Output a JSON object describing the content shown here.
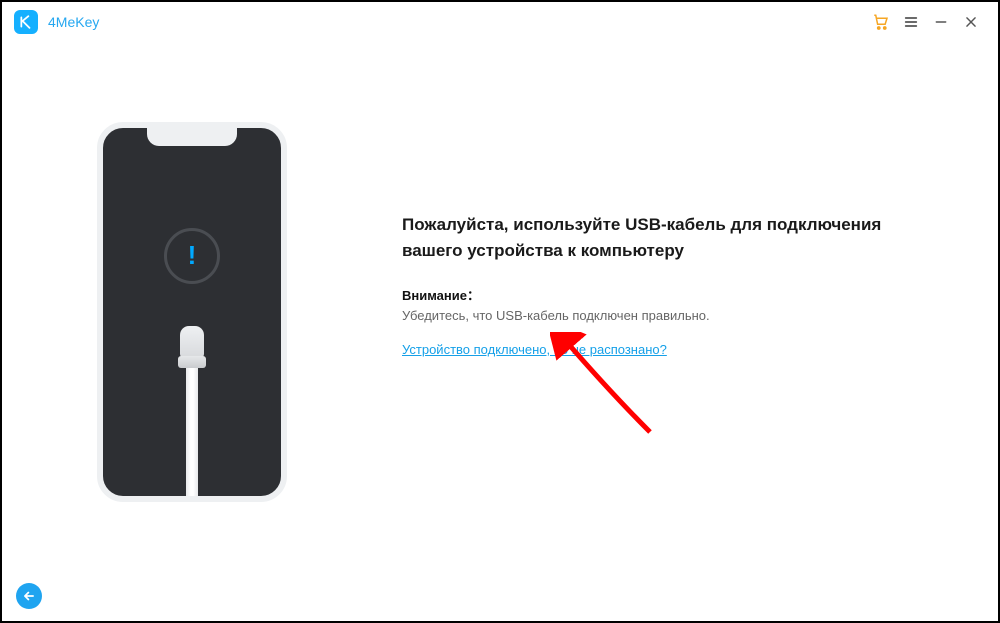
{
  "app": {
    "title": "4MeKey"
  },
  "titlebar": {
    "cart": "cart-icon",
    "menu": "menu-icon",
    "minimize": "minimize-icon",
    "close": "close-icon"
  },
  "main": {
    "heading": "Пожалуйста, используйте USB-кабель для подключения вашего устройства к компьютеру",
    "note_label": "Внимание：",
    "note_text": "Убедитесь, что USB-кабель подключен правильно.",
    "help_link": "Устройство подключено, но не распознано?"
  },
  "footer": {
    "back": "back"
  }
}
